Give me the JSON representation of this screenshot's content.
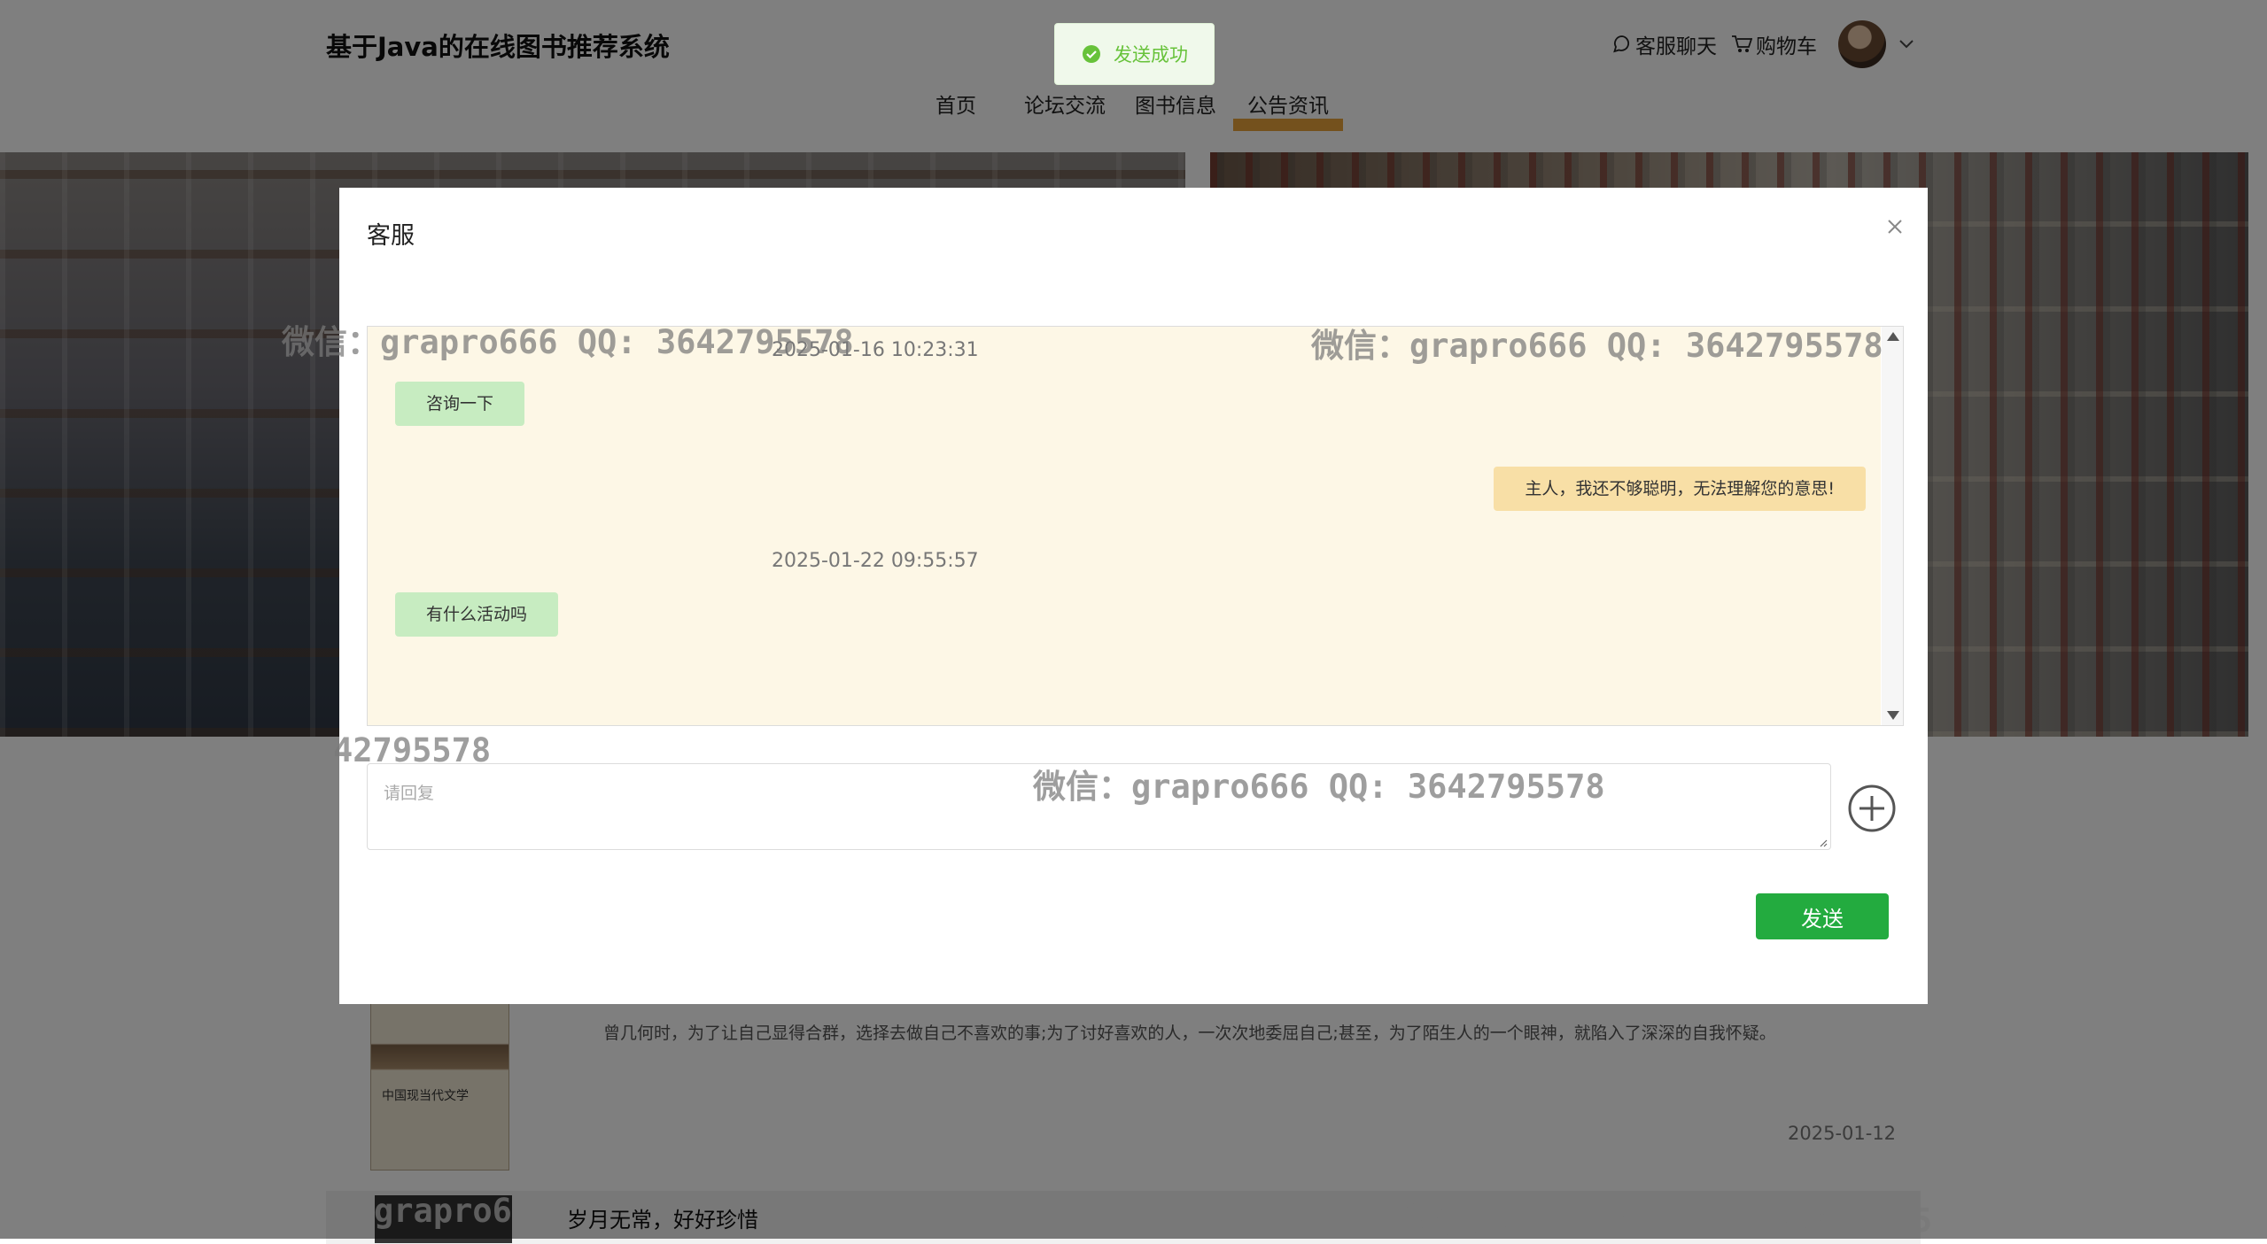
{
  "header": {
    "site_title": "基于Java的在线图书推荐系统",
    "nav": [
      "首页",
      "论坛交流",
      "图书信息",
      "公告资讯"
    ],
    "active_nav": "公告资讯",
    "customer_chat": "客服聊天",
    "cart": "购物车",
    "accent_color": "#e8a33a"
  },
  "notices": {
    "item1_text": "曾几何时，为了让自己显得合群，选择去做自己不喜欢的事;为了讨好喜欢的人，一次次地委屈自己;甚至，为了陌生人的一个眼神，就陷入了深深的自我怀疑。",
    "item1_date": "2025-01-12",
    "item1_cover_title": "中国现当代文学",
    "item2_title": "岁月无常，好好珍惜"
  },
  "dialog": {
    "title": "客服",
    "messages": [
      {
        "type": "time",
        "text": "2025-01-16 10:23:31"
      },
      {
        "type": "user",
        "text": "咨询一下"
      },
      {
        "type": "bot",
        "text": "主人，我还不够聪明，无法理解您的意思!"
      },
      {
        "type": "time",
        "text": "2025-01-22 09:55:57"
      },
      {
        "type": "user",
        "text": "有什么活动吗"
      }
    ],
    "reply_placeholder": "请回复",
    "send_label": "发送",
    "send_color": "#23ab3f"
  },
  "toast": {
    "text": "发送成功",
    "icon": "check-circle-icon"
  },
  "watermarks": [
    "微信：grapro666 QQ: 3642795578",
    "微信：grapro666 QQ: 3642795578",
    "42795578",
    "微信：grapro666 QQ: 3642795578",
    "grapro6",
    "微信：grapro666 QQ: 36427955"
  ]
}
